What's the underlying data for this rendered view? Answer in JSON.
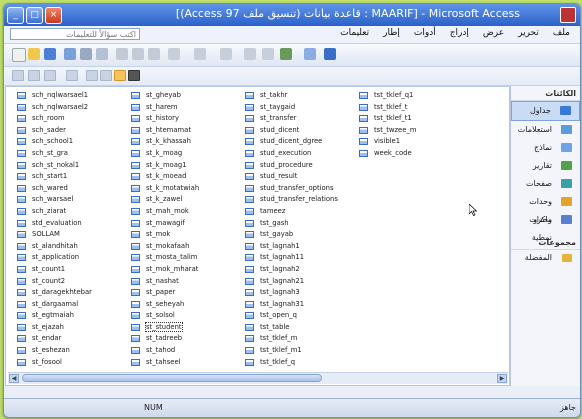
{
  "window": {
    "title": "Microsoft Access - [MAARIF : قاعدة بيانات (تنسيق ملف Access 97)]",
    "controls": [
      "_",
      "□",
      "×"
    ]
  },
  "menubar": {
    "items": [
      "ملف",
      "تحرير",
      "عرض",
      "إدراج",
      "أدوات",
      "إطار",
      "تعليمات"
    ],
    "help_placeholder": "اكتب سؤالاً للتعليمات"
  },
  "sidepanel": {
    "objects_header": "الكائنات",
    "items": [
      {
        "label": "جداول",
        "icon": "table-icon",
        "color": "#3a78d8",
        "selected": true
      },
      {
        "label": "استعلامات",
        "icon": "query-icon",
        "color": "#5b9be0",
        "selected": false
      },
      {
        "label": "نماذج",
        "icon": "form-icon",
        "color": "#6ea4e6",
        "selected": false
      },
      {
        "label": "تقارير",
        "icon": "report-icon",
        "color": "#4fa44a",
        "selected": false
      },
      {
        "label": "صفحات",
        "icon": "page-icon",
        "color": "#3aa0a8",
        "selected": false
      },
      {
        "label": "وحدات ماكرو",
        "icon": "macro-icon",
        "color": "#e0a52a",
        "selected": false
      },
      {
        "label": "وحدات نمطية",
        "icon": "module-icon",
        "color": "#5a7fd0",
        "selected": false
      }
    ],
    "groups_header": "مجموعات",
    "groups": [
      {
        "label": "المفضلة",
        "icon": "favorites-folder-icon"
      }
    ]
  },
  "tables": [
    "sch_nqlwarsael1",
    "sch_nqlwarsael2",
    "sch_room",
    "sch_sader",
    "sch_school1",
    "sch_st_gra",
    "sch_st_nokal1",
    "sch_start1",
    "sch_wared",
    "sch_warsael",
    "sch_ziarat",
    "std_evaluation",
    "SOLLAM",
    "st_alandhitah",
    "st_application",
    "st_count1",
    "st_count2",
    "st_daragekhtebar",
    "st_dargaamal",
    "st_egtmaiah",
    "st_ejazah",
    "st_endar",
    "st_eshezan",
    "st_fosool",
    "st_gheyab",
    "st_harem",
    "st_history",
    "st_htemamat",
    "st_k_khassah",
    "st_k_moag",
    "st_k_moag1",
    "st_k_moead",
    "st_k_motatwiah",
    "st_k_zawel",
    "st_mah_mok",
    "st_mawagif",
    "st_mok",
    "st_mokafaah",
    "st_mosta_talim",
    "st_mok_mharat",
    "st_nashat",
    "st_paper",
    "st_seheyah",
    "st_solsol",
    "st_student",
    "st_tadreeb",
    "st_tahod",
    "st_tahseel",
    "st_takhr",
    "st_taygaid",
    "st_transfer",
    "stud_dicent",
    "stud_dicent_dgree",
    "stud_execution",
    "stud_procedure",
    "stud_result",
    "stud_transfer_options",
    "stud_transfer_relations",
    "tameez",
    "tst_gash",
    "tst_gayab",
    "tst_lagnah1",
    "tst_lagnah11",
    "tst_lagnah2",
    "tst_lagnah21",
    "tst_lagnah3",
    "tst_lagnah31",
    "tst_open_q",
    "tst_table",
    "tst_tklef_m",
    "tst_tklef_m1",
    "tst_tklef_q",
    "tst_tklef_q1",
    "tst_tklef_t",
    "tst_tklef_t1",
    "tst_twzee_m",
    "visible1",
    "week_code"
  ],
  "selected_table": "st_student",
  "statusbar": {
    "num": "NUM",
    "ready": "جاهز"
  }
}
